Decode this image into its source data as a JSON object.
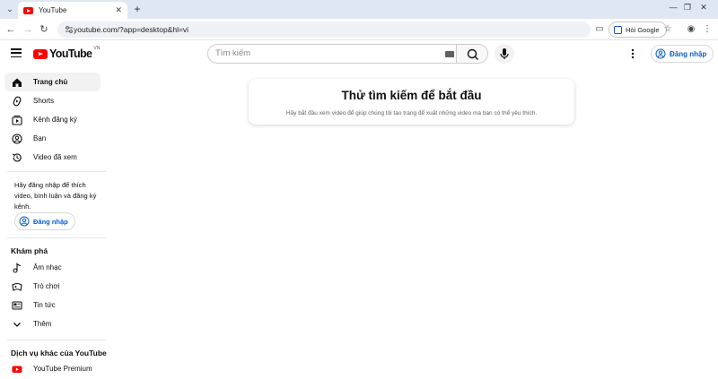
{
  "browser": {
    "tab_title": "YouTube",
    "url": "youtube.com/?app=desktop&hl=vi",
    "ask_google_label": "Hỏi Google"
  },
  "masthead": {
    "logo_text": "YouTube",
    "country_code": "VN",
    "search_placeholder": "Tìm kiếm",
    "signin_label": "Đăng nhập"
  },
  "sidebar": {
    "primary": [
      {
        "label": "Trang chủ",
        "icon": "home-icon"
      },
      {
        "label": "Shorts",
        "icon": "shorts-icon"
      },
      {
        "label": "Kênh đăng ký",
        "icon": "subscriptions-icon"
      },
      {
        "label": "Bạn",
        "icon": "you-icon"
      },
      {
        "label": "Video đã xem",
        "icon": "history-icon"
      }
    ],
    "signin_note": "Hãy đăng nhập để thích video, bình luận và đăng ký kênh.",
    "signin_label": "Đăng nhập",
    "explore_heading": "Khám phá",
    "explore": [
      {
        "label": "Âm nhạc",
        "icon": "music-icon"
      },
      {
        "label": "Trò chơi",
        "icon": "gaming-icon"
      },
      {
        "label": "Tin tức",
        "icon": "news-icon"
      },
      {
        "label": "Thêm",
        "icon": "chevron-down-icon"
      }
    ],
    "more_heading": "Dịch vụ khác của YouTube",
    "more": [
      {
        "label": "YouTube Premium",
        "icon": "youtube-premium-icon"
      }
    ]
  },
  "main": {
    "title": "Thử tìm kiếm để bắt đầu",
    "subtitle": "Hãy bắt đầu xem video để giúp chúng tôi tạo trang để xuất những video mà bạn có thể yêu thích."
  },
  "colors": {
    "brand_red": "#ff0000",
    "link_blue": "#065fd4"
  }
}
